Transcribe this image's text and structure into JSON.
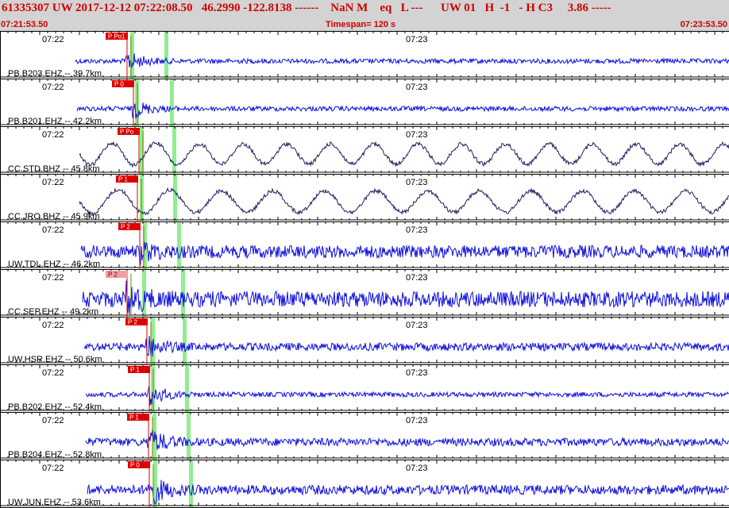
{
  "header": {
    "line1": "61335307 UW 2017-12-12 07:22:08.50   46.2990 -122.8138 ------    NaN M    eq   L ---      UW 01   H  -1   - H C3     3.86 -----",
    "start_time": "07:21:53.50",
    "timespan": "Timespan= 120 s",
    "end_time": "07:23:53.50"
  },
  "time_labels": [
    "07:22",
    "07:23"
  ],
  "colors": {
    "trace_blue": "#1010e0",
    "trace_navy": "#202060",
    "pick_red": "#dd0000",
    "pick_pink": "#f0a0a0",
    "model_green": "#90ee90",
    "theory_olive": "#808000",
    "header_bg": "#d3d3d3"
  },
  "channels": [
    {
      "label": "PB.B203.EHZ -- 39.7km",
      "pick": "P Po1",
      "pick_pink": false,
      "wave": "hf",
      "amp": 3,
      "burst": 12
    },
    {
      "label": "PB.B201.EHZ -- 42.2km",
      "pick": "P 0",
      "pick_pink": false,
      "wave": "hf",
      "amp": 3,
      "burst": 11
    },
    {
      "label": "CC.STD.BHZ -- 45.8km",
      "pick": "P Po",
      "pick_pink": false,
      "wave": "lf",
      "amp": 14,
      "burst": 4
    },
    {
      "label": "CC.JRO.BHZ -- 45.9km",
      "pick": "P 1",
      "pick_pink": false,
      "wave": "lf",
      "amp": 15,
      "burst": 4
    },
    {
      "label": "UW.TDL.EHZ -- 46.2km",
      "pick": "P 2",
      "pick_pink": false,
      "wave": "noisy",
      "amp": 8,
      "burst": 10
    },
    {
      "label": "CC.SEP.EHZ -- 49.2km",
      "pick": "P 2",
      "pick_pink": true,
      "wave": "noisy",
      "amp": 10,
      "burst": 16
    },
    {
      "label": "UW.HSR.EHZ -- 50.6km",
      "pick": "P 2",
      "pick_pink": false,
      "wave": "hf",
      "amp": 5,
      "burst": 12
    },
    {
      "label": "PB.B202.EHZ -- 52.4km",
      "pick": "P 1",
      "pick_pink": false,
      "wave": "hf",
      "amp": 3,
      "burst": 14
    },
    {
      "label": "PB.B204.EHZ -- 52.8km",
      "pick": "P 1",
      "pick_pink": false,
      "wave": "hf",
      "amp": 5,
      "burst": 16
    },
    {
      "label": "UW.JUN.EHZ -- 53.6km",
      "pick": "P 0",
      "pick_pink": false,
      "wave": "noisy",
      "amp": 6,
      "burst": 18
    }
  ]
}
